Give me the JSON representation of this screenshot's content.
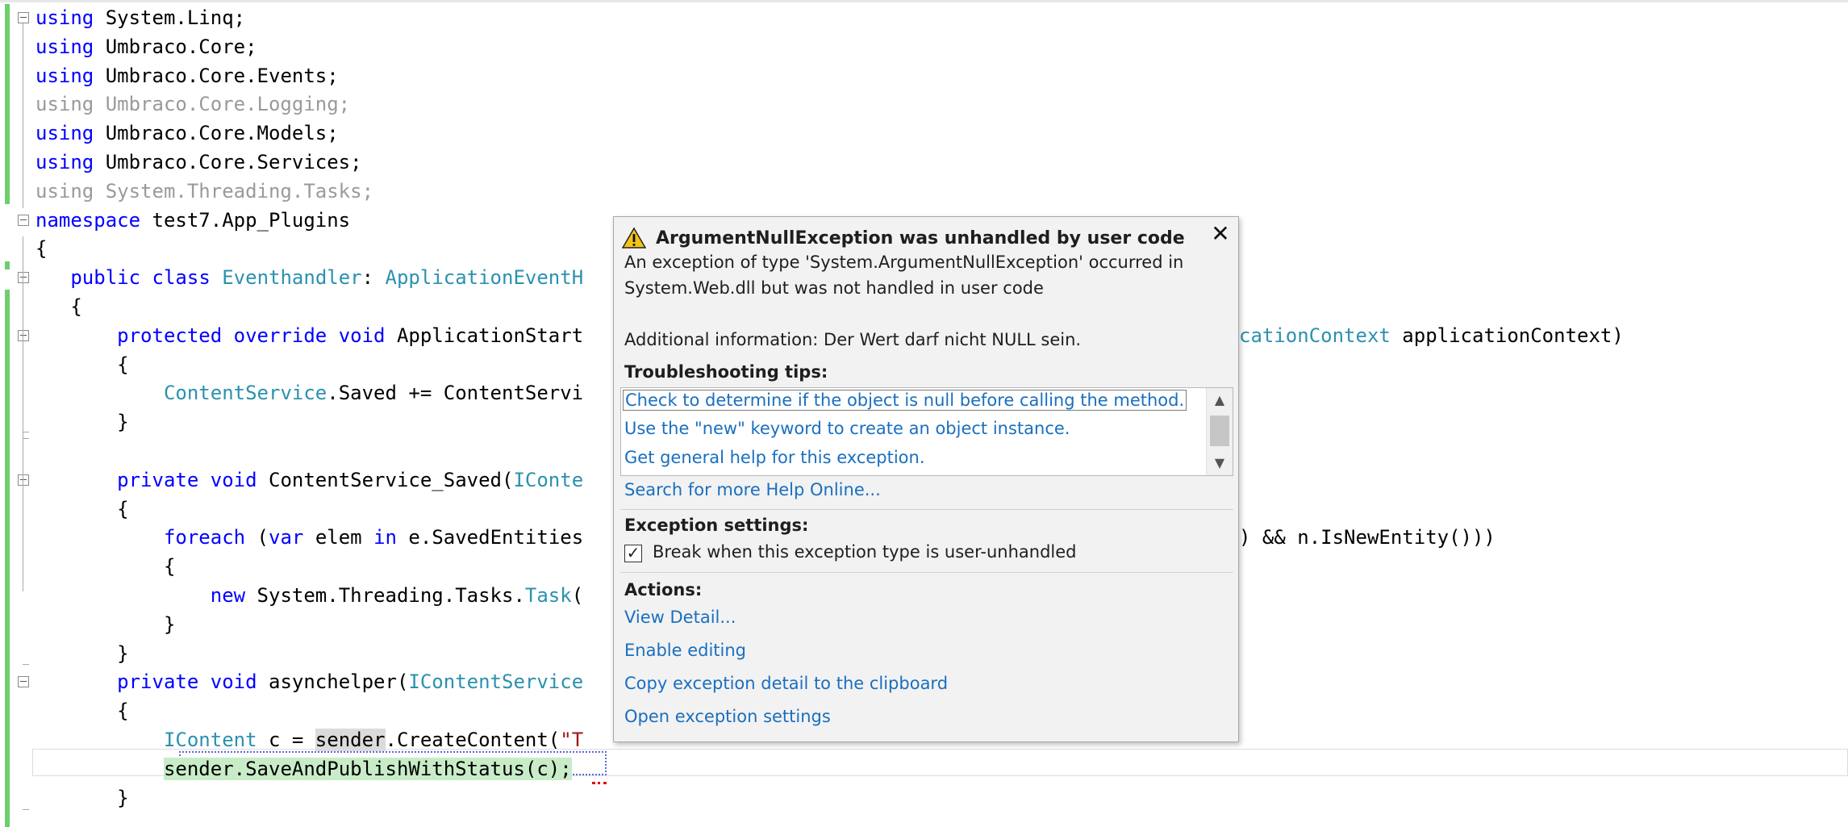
{
  "code": {
    "lines": [
      [
        [
          "kw",
          "using"
        ],
        [
          "",
          "  System.Linq;"
        ]
      ],
      [
        [
          "kw",
          "using"
        ],
        [
          "",
          "  Umbraco.Core;"
        ]
      ],
      [
        [
          "kw",
          "using"
        ],
        [
          "",
          "  Umbraco.Core.Events;"
        ]
      ],
      [
        [
          "dim",
          "using  Umbraco.Core.Logging;"
        ]
      ],
      [
        [
          "kw",
          "using"
        ],
        [
          "",
          "  Umbraco.Core.Models;"
        ]
      ],
      [
        [
          "kw",
          "using"
        ],
        [
          "",
          "  Umbraco.Core.Services;"
        ]
      ],
      [
        [
          "dim",
          "using  System.Threading.Tasks;"
        ]
      ],
      [
        [
          "kw",
          "namespace"
        ],
        [
          "",
          "  test7.App_Plugins"
        ]
      ],
      [
        [
          "",
          "{"
        ]
      ],
      [
        [
          "",
          "    "
        ],
        [
          "kw",
          "public"
        ],
        [
          "",
          " "
        ],
        [
          "kw",
          "class"
        ],
        [
          "",
          " "
        ],
        [
          "ty",
          "Eventhandler"
        ],
        [
          "",
          ": "
        ],
        [
          "ty",
          "ApplicationEventH"
        ]
      ],
      [
        [
          "",
          "    {"
        ]
      ],
      [
        [
          "",
          "        "
        ],
        [
          "kw",
          "protected"
        ],
        [
          "",
          " "
        ],
        [
          "kw",
          "override"
        ],
        [
          "",
          " "
        ],
        [
          "kw",
          "void"
        ],
        [
          "",
          " ApplicationStart"
        ]
      ],
      [
        [
          "",
          "        {"
        ]
      ],
      [
        [
          "",
          "            "
        ],
        [
          "ty",
          "ContentService"
        ],
        [
          "",
          ".Saved += ContentServi"
        ]
      ],
      [
        [
          "",
          "        }"
        ]
      ],
      [
        [
          "",
          ""
        ]
      ],
      [
        [
          "",
          "        "
        ],
        [
          "kw",
          "private"
        ],
        [
          "",
          " "
        ],
        [
          "kw",
          "void"
        ],
        [
          "",
          " ContentService_Saved("
        ],
        [
          "ty",
          "IConte"
        ]
      ],
      [
        [
          "",
          "        {"
        ]
      ],
      [
        [
          "",
          "            "
        ],
        [
          "kw",
          "foreach"
        ],
        [
          "",
          " ("
        ],
        [
          "kw",
          "var"
        ],
        [
          "",
          " elem "
        ],
        [
          "kw",
          "in"
        ],
        [
          "",
          " e.SavedEntities"
        ]
      ],
      [
        [
          "",
          "            {"
        ]
      ],
      [
        [
          "",
          "                "
        ],
        [
          "kw",
          "new"
        ],
        [
          "",
          " System.Threading.Tasks."
        ],
        [
          "ty",
          "Task"
        ],
        [
          "",
          "("
        ]
      ],
      [
        [
          "",
          "            }"
        ]
      ],
      [
        [
          "",
          "        }"
        ]
      ],
      [
        [
          "",
          "        "
        ],
        [
          "kw",
          "private"
        ],
        [
          "",
          " "
        ],
        [
          "kw",
          "void"
        ],
        [
          "",
          " asynchelper("
        ],
        [
          "ty",
          "IContentService"
        ]
      ],
      [
        [
          "",
          "        {"
        ]
      ],
      [
        [
          "",
          "            "
        ],
        [
          "ty",
          "IContent"
        ],
        [
          "",
          " c = "
        ],
        [
          "hl",
          "sender"
        ],
        [
          "",
          ".CreateContent("
        ],
        [
          "str",
          "\"T"
        ]
      ],
      [
        [
          "",
          "            "
        ],
        [
          "hl-green",
          "sender.SaveAndPublishWithStatus(c);"
        ]
      ],
      [
        [
          "",
          "        }"
        ]
      ]
    ],
    "right_fragments": [
      {
        "line": 11,
        "parts": [
          [
            "ty",
            "cationContext"
          ],
          [
            "",
            " applicationContext)"
          ]
        ]
      },
      {
        "line": 18,
        "parts": [
          [
            "",
            ") && n.IsNewEntity()))"
          ]
        ]
      }
    ]
  },
  "popup": {
    "title": "ArgumentNullException was unhandled by user code",
    "close_glyph": "✕",
    "message_line1": "An exception of type 'System.ArgumentNullException' occurred in",
    "message_line2": "System.Web.dll but was not handled in user code",
    "additional_info": "Additional information: Der Wert darf nicht NULL sein.",
    "troubleshooting_heading": "Troubleshooting tips:",
    "tips": [
      "Check to determine if the object is null before calling the method.",
      "Use the \"new\" keyword to create an object instance.",
      "Get general help for this exception."
    ],
    "search_link": "Search for more Help Online...",
    "exception_settings_heading": "Exception settings:",
    "break_checkbox_label": "Break when this exception type is user-unhandled",
    "break_checked": true,
    "actions_heading": "Actions:",
    "actions": [
      "View Detail...",
      "Enable editing",
      "Copy exception detail to the clipboard",
      "Open exception settings"
    ]
  },
  "colors": {
    "keyword": "#0000ff",
    "type": "#2b91af",
    "string": "#a31515",
    "link": "#1a6fbf",
    "change_bar": "#6ccf6c"
  },
  "icons": {
    "warning": "warning-triangle-icon",
    "close": "close-icon",
    "checkbox": "checkmark-icon",
    "scroll_up": "chevron-up-icon",
    "scroll_down": "chevron-down-icon"
  }
}
